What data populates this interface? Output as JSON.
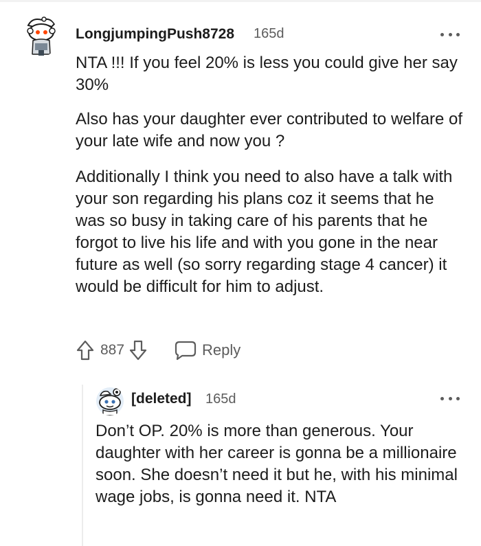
{
  "comment": {
    "username": "LongjumpingPush8728",
    "age": "165d",
    "paragraphs": [
      "NTA !!! If you feel 20% is less you could give her say 30%",
      "Also has your daughter ever contributed to welfare of your late wife and now you ?",
      "Additionally I think you need to also have a talk with your son regarding his plans coz it seems that he was so busy in taking care of his parents that he forgot to live his life and with you gone in the near future as well (so sorry regarding stage 4 cancer) it would be difficult for him to adjust."
    ],
    "votes": "887",
    "reply_label": "Reply",
    "icons": [
      "snoo-avatar-icon",
      "more-options-icon",
      "upvote-icon",
      "downvote-icon",
      "reply-bubble-icon"
    ]
  },
  "reply": {
    "username": "[deleted]",
    "age": "165d",
    "body": "Don’t OP. 20% is more than generous. Your daughter with her career is gonna be a millionaire soon. She doesn’t need it but he, with his minimal wage jobs, is gonna need it. NTA",
    "icons": [
      "snoo-avatar-icon",
      "more-options-icon"
    ]
  },
  "colors": {
    "text": "#1c1c1c",
    "meta": "#5c5c5c",
    "accent_red": "#ff4500"
  }
}
